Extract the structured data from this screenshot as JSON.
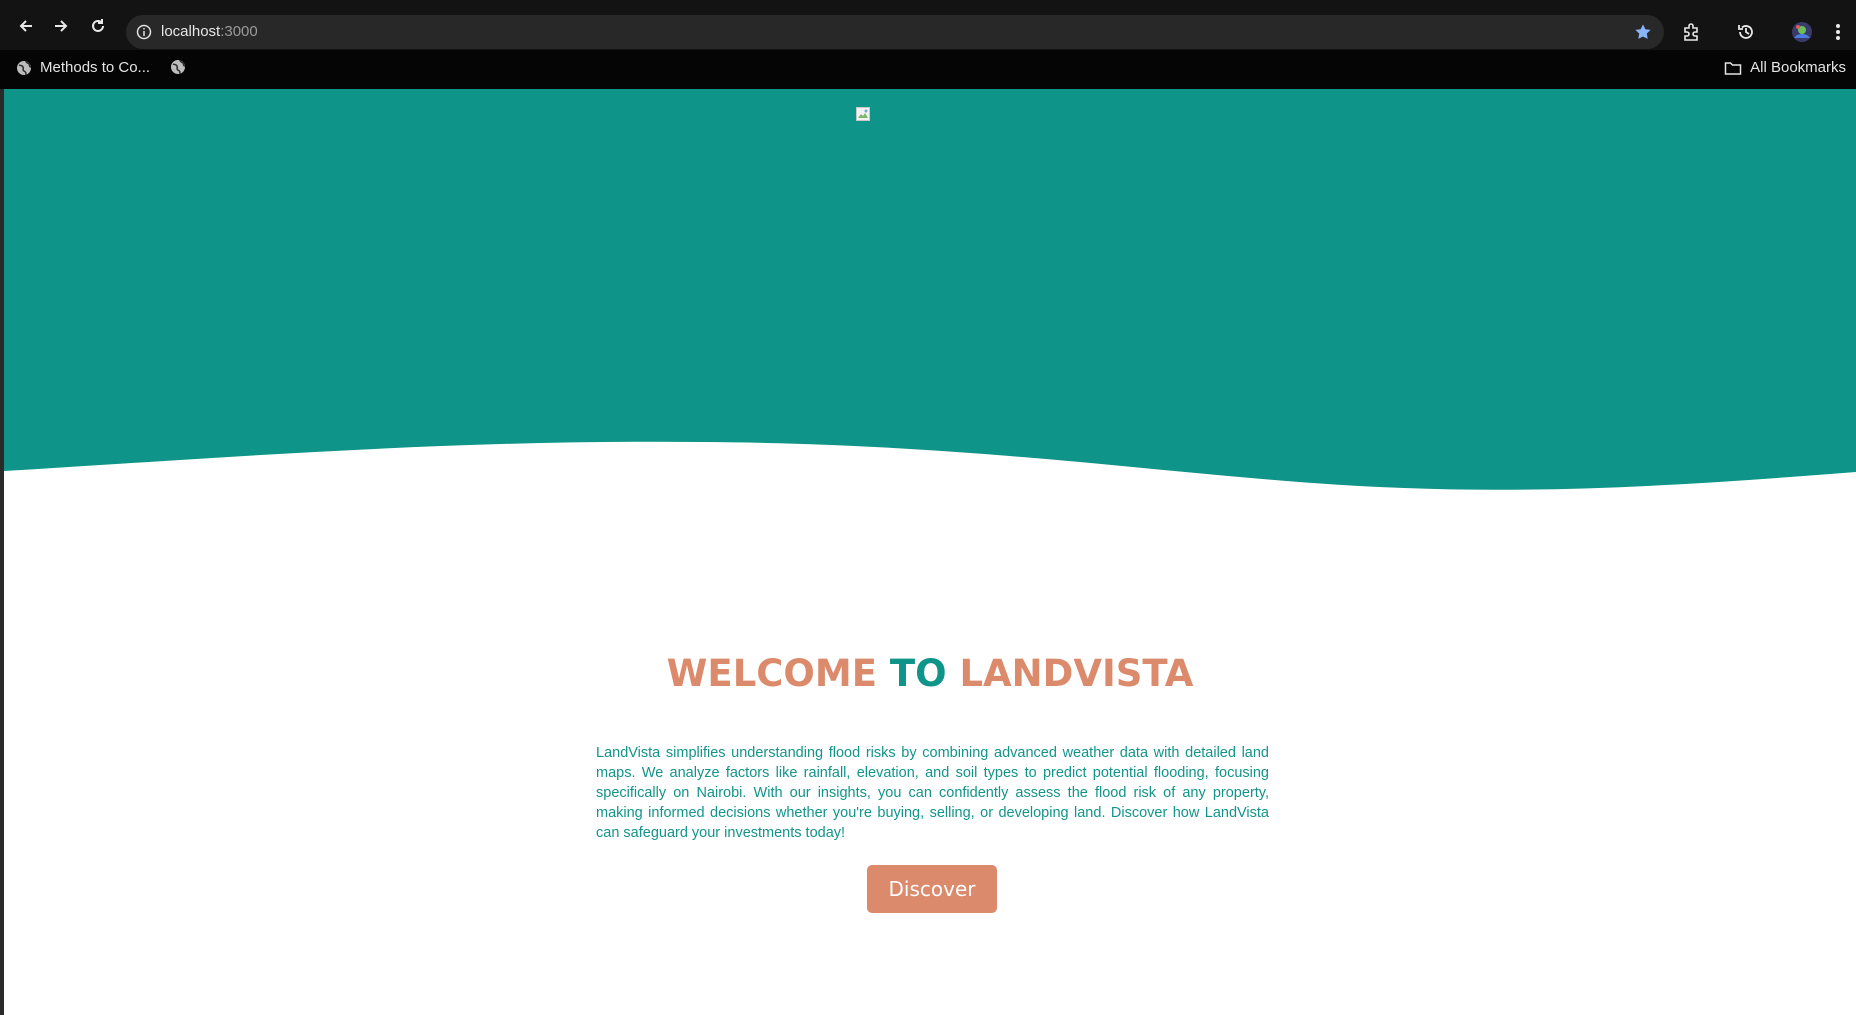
{
  "browser": {
    "url_host": "localhost",
    "url_port": ":3000",
    "bookmarks": [
      {
        "label": "Methods to Co..."
      }
    ],
    "all_bookmarks_label": "All Bookmarks",
    "icons": [
      "back-icon",
      "forward-icon",
      "reload-icon",
      "info-icon",
      "star-icon",
      "extensions-icon",
      "history-icon",
      "profile-avatar-icon",
      "menu-icon",
      "globe-icon",
      "folder-icon"
    ]
  },
  "colors": {
    "hero_teal": "#0e9488",
    "accent_orange": "#db8a6c",
    "body_text": "#13948a"
  },
  "hero": {
    "welcome_part1": "WELCOME ",
    "welcome_part2": "TO",
    "welcome_part3": " LANDVISTA",
    "description": "LandVista simplifies understanding flood risks by combining advanced weather data with detailed land maps. We analyze factors like rainfall, elevation, and soil types to predict potential flooding, focusing specifically on Nairobi. With our insights, you can confidently assess the flood risk of any property, making informed decisions whether you're buying, selling, or developing land. Discover how LandVista can safeguard your investments today!",
    "discover_label": "Discover"
  }
}
